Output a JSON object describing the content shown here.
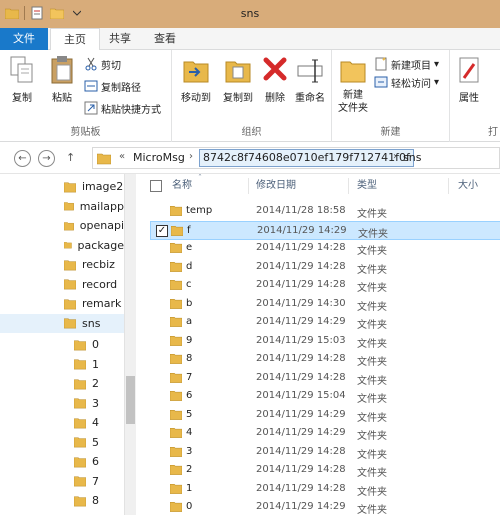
{
  "window": {
    "title": "sns"
  },
  "tabs": {
    "file": "文件",
    "home": "主页",
    "share": "共享",
    "view": "查看"
  },
  "ribbon": {
    "clipboard": {
      "label": "剪贴板",
      "copy": "复制",
      "paste": "粘贴",
      "cut": "剪切",
      "copy_path": "复制路径",
      "paste_shortcut": "粘贴快捷方式"
    },
    "organize": {
      "label": "组织",
      "move_to": "移动到",
      "copy_to": "复制到",
      "delete": "删除",
      "rename": "重命名"
    },
    "new": {
      "label": "新建",
      "new_folder": "新建\n文件夹",
      "new_item": "新建项目",
      "easy_access": "轻松访问"
    },
    "open": {
      "label": "打",
      "properties": "属性"
    }
  },
  "address": {
    "crumbs": [
      "MicroMsg",
      "8742c8f74608e0710ef179f712741f0f",
      "sns"
    ],
    "overflow": "«"
  },
  "navpane": {
    "items": [
      "image2",
      "mailapp",
      "openapi",
      "package",
      "recbiz",
      "record",
      "remark",
      "sns"
    ],
    "sub_items": [
      "0",
      "1",
      "2",
      "3",
      "4",
      "5",
      "6",
      "7",
      "8"
    ]
  },
  "columns": {
    "name": "名称",
    "date": "修改日期",
    "type": "类型",
    "size": "大小"
  },
  "files": [
    {
      "name": "temp",
      "date": "2014/11/28 18:58",
      "type": "文件夹"
    },
    {
      "name": "f",
      "date": "2014/11/29 14:29",
      "type": "文件夹"
    },
    {
      "name": "e",
      "date": "2014/11/29 14:28",
      "type": "文件夹"
    },
    {
      "name": "d",
      "date": "2014/11/29 14:28",
      "type": "文件夹"
    },
    {
      "name": "c",
      "date": "2014/11/29 14:28",
      "type": "文件夹"
    },
    {
      "name": "b",
      "date": "2014/11/29 14:30",
      "type": "文件夹"
    },
    {
      "name": "a",
      "date": "2014/11/29 14:29",
      "type": "文件夹"
    },
    {
      "name": "9",
      "date": "2014/11/29 15:03",
      "type": "文件夹"
    },
    {
      "name": "8",
      "date": "2014/11/29 14:28",
      "type": "文件夹"
    },
    {
      "name": "7",
      "date": "2014/11/29 14:28",
      "type": "文件夹"
    },
    {
      "name": "6",
      "date": "2014/11/29 15:04",
      "type": "文件夹"
    },
    {
      "name": "5",
      "date": "2014/11/29 14:29",
      "type": "文件夹"
    },
    {
      "name": "4",
      "date": "2014/11/29 14:29",
      "type": "文件夹"
    },
    {
      "name": "3",
      "date": "2014/11/29 14:28",
      "type": "文件夹"
    },
    {
      "name": "2",
      "date": "2014/11/29 14:28",
      "type": "文件夹"
    },
    {
      "name": "1",
      "date": "2014/11/29 14:28",
      "type": "文件夹"
    },
    {
      "name": "0",
      "date": "2014/11/29 14:29",
      "type": "文件夹"
    }
  ],
  "selected_file": "f",
  "colors": {
    "file_tab": "#1979ca",
    "title_bar": "#d8ac7a",
    "selection": "#cce8ff",
    "folder": "#e8b84a"
  }
}
